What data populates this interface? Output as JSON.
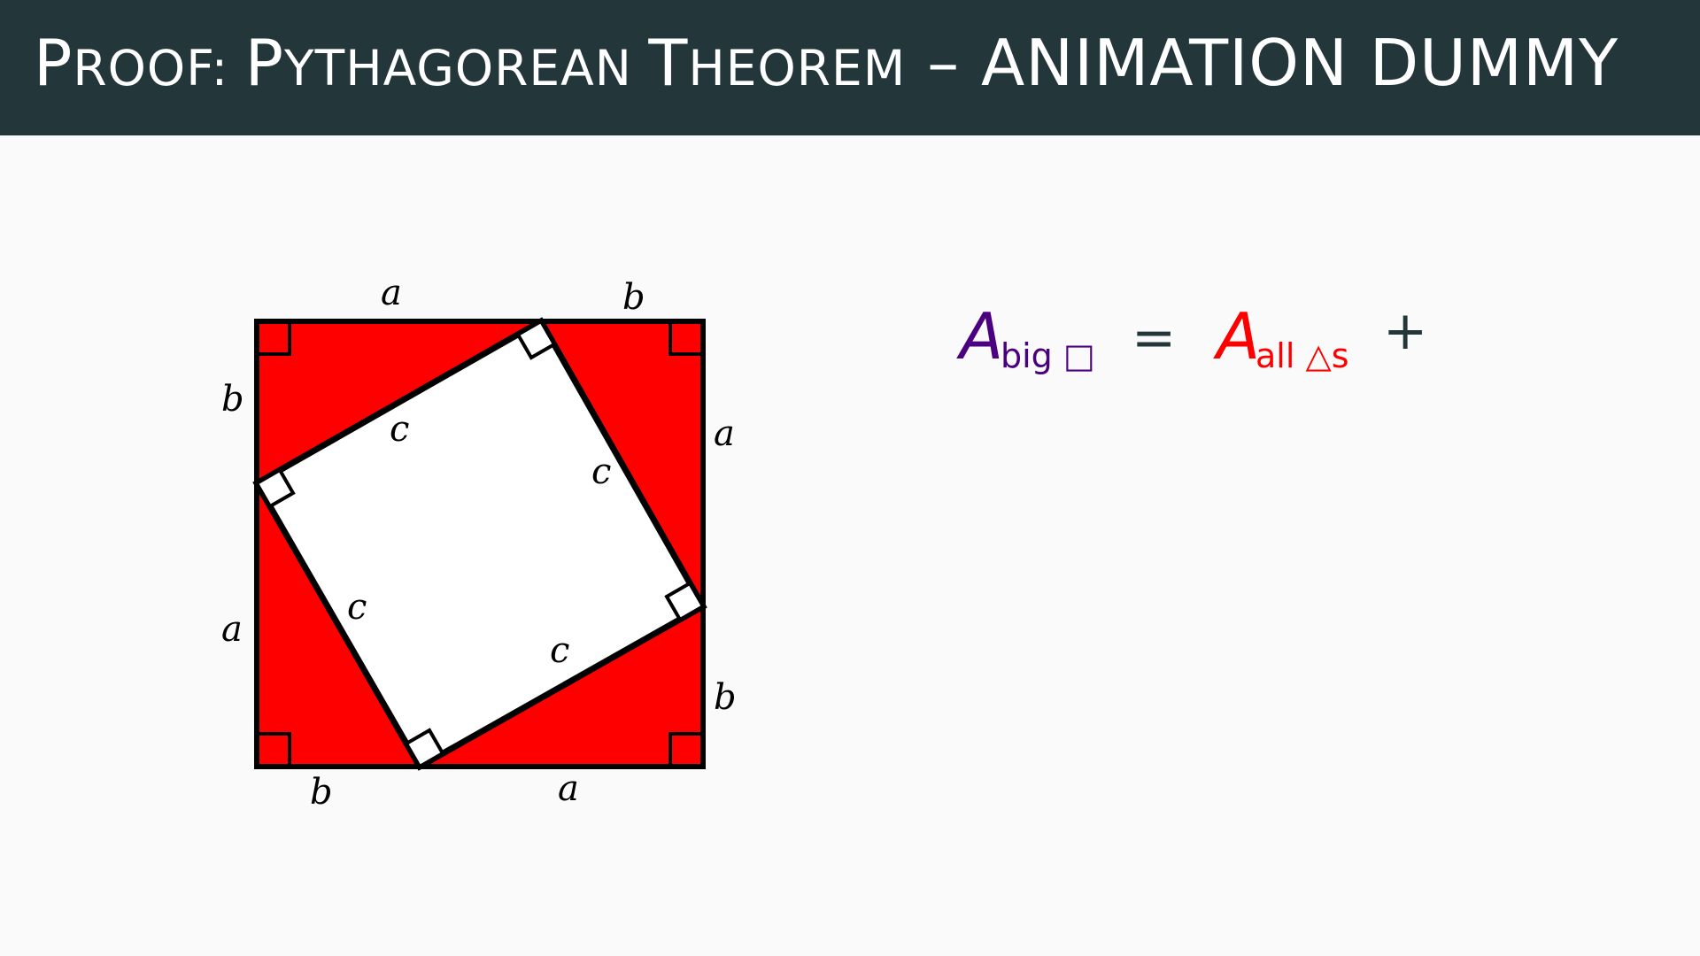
{
  "slide": {
    "title_first_letter": "P",
    "title_rest_smallcaps": "roof: ",
    "title_p2_first": "P",
    "title_p2_rest": "ythagorean ",
    "title_p3_first": "T",
    "title_p3_rest": "heorem",
    "title_suffix": " – ANIMATION DUMMY",
    "colors": {
      "header_bg": "#23373b",
      "background": "#fafafa",
      "triangle_fill": "#ff0000",
      "outline": "#000000",
      "big_square_label": "#4b0082",
      "triangles_label": "#ff0000",
      "operator": "#23373b"
    }
  },
  "diagram": {
    "labels": {
      "top_left": "a",
      "top_right": "b",
      "left_top": "b",
      "left_bottom": "a",
      "right_top": "a",
      "right_bottom": "b",
      "bottom_left": "b",
      "bottom_right": "a",
      "hyp_top": "c",
      "hyp_right": "c",
      "hyp_left": "c",
      "hyp_bottom": "c"
    }
  },
  "formula": {
    "big_square_var": "A",
    "big_square_sub": "big □",
    "equals": "=",
    "triangles_var": "A",
    "triangles_sub": "all △s",
    "plus": "+"
  }
}
